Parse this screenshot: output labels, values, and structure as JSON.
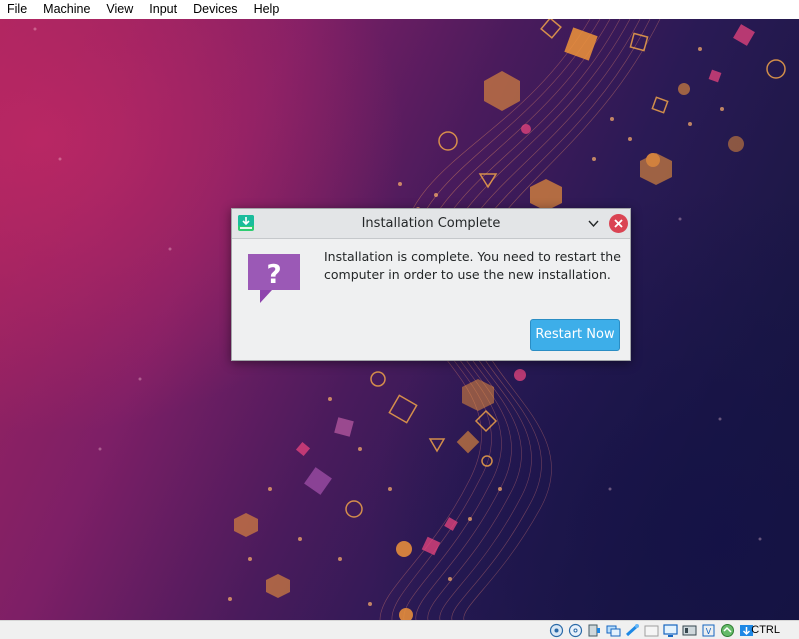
{
  "menu": {
    "items": [
      "File",
      "Machine",
      "View",
      "Input",
      "Devices",
      "Help"
    ]
  },
  "dialog": {
    "title": "Installation Complete",
    "app_icon": "installer-download-icon",
    "question_icon": "question-bubble-icon",
    "message": "Installation is complete. You need to restart the computer in order to use the new installation.",
    "button_label": "Restart Now",
    "colors": {
      "accent": "#3daee9",
      "close": "#da4453",
      "question_bubble": "#9b59b6"
    }
  },
  "statusbar": {
    "icons": [
      "hard-disk-icon",
      "optical-drive-icon",
      "audio-icon",
      "network-icon",
      "usb-icon",
      "shared-folders-icon",
      "display-icon",
      "recording-icon",
      "cpu-icon",
      "mouse-integration-icon",
      "keyboard-capture-icon"
    ],
    "host_key": "CTRL"
  },
  "wallpaper": {
    "colors": [
      "#a5245e",
      "#4a1b5c",
      "#16153d",
      "#f0943a"
    ]
  }
}
